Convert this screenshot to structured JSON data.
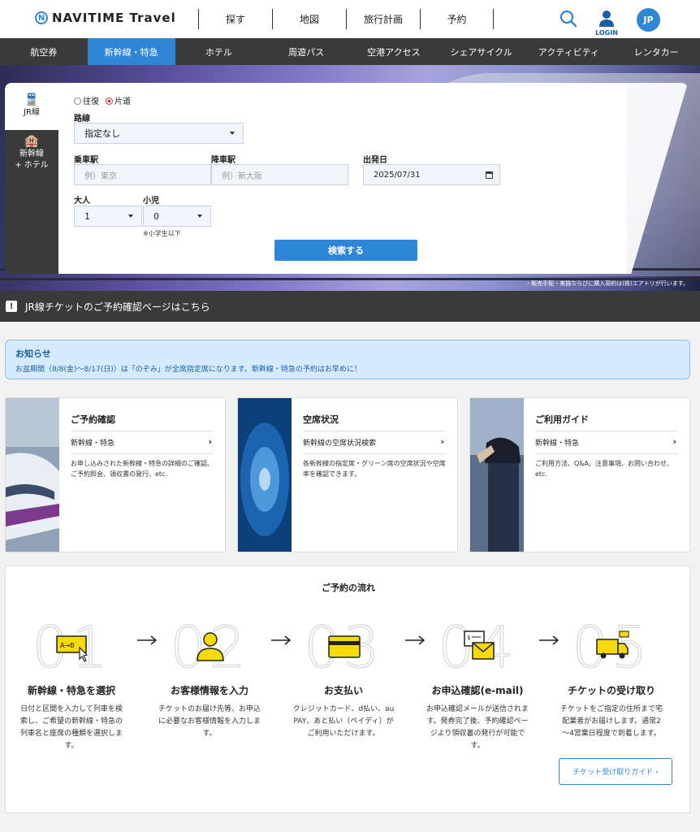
{
  "header": {
    "logo_mark": "N",
    "logo_text": "NAVITIME Travel",
    "nav": [
      "探す",
      "地図",
      "旅行計画",
      "予約"
    ],
    "login_label": "LOGIN",
    "avatar": "JP"
  },
  "categories": [
    "航空券",
    "新幹線・特急",
    "ホテル",
    "周遊パス",
    "空港アクセス",
    "シェアサイクル",
    "アクティビティ",
    "レンタカー"
  ],
  "active_category": "新幹線・特急",
  "sidebar": {
    "tabs": [
      {
        "label": "JR線",
        "icon": "train-icon"
      },
      {
        "label": "新幹線\n+ ホテル",
        "icon": "train-hotel-icon"
      }
    ]
  },
  "form": {
    "trip_round": "往復",
    "trip_oneway": "片道",
    "route_label": "路線",
    "route_value": "指定なし",
    "from_label": "乗車駅",
    "from_placeholder": "例）東京",
    "to_label": "降車駅",
    "to_placeholder": "例）新大阪",
    "date_label": "出発日",
    "date_value": "2025/07/31",
    "adult_label": "大人",
    "adult_value": "1",
    "child_label": "小児",
    "child_value": "0",
    "child_note": "※小学生以下",
    "search_button": "検索する"
  },
  "hero_disclaimer": "・販売手配・実施ならびに購入契約は(株)エアトリが行います。",
  "confirm_bar": {
    "icon": "!",
    "text": "JR線チケットのご予約確認ページはこちら"
  },
  "notice": {
    "title": "お知らせ",
    "text": "お盆期間（8/8(金)～8/17(日)）は「のぞみ」が全席指定席になります。新幹線・特急の予約はお早めに！"
  },
  "cards": [
    {
      "title": "ご予約確認",
      "link": "新幹線・特急",
      "desc": "お申し込みされた新幹線・特急の詳細のご確認、ご予約照会、領収書の発行、etc."
    },
    {
      "title": "空席状況",
      "link": "新幹線の空席状況検索",
      "desc": "各新幹線の指定席・グリーン席の空席状況や空席率を確認できます。"
    },
    {
      "title": "ご利用ガイド",
      "link": "新幹線・特急",
      "desc": "ご利用方法、Q&A、注意事項、お問い合わせ、etc."
    }
  ],
  "flow": {
    "title": "ご予約の流れ",
    "steps": [
      {
        "num": "01",
        "title": "新幹線・特急を選択",
        "desc": "日付と区間を入力して列車を検索し、ご希望の新幹線・特急の列車名と座席の種類を選択します。",
        "icon": "route-select-icon"
      },
      {
        "num": "02",
        "title": "お客様情報を入力",
        "desc": "チケットのお届け先等、お申込に必要なお客様情報を入力します。",
        "icon": "person-icon"
      },
      {
        "num": "03",
        "title": "お支払い",
        "desc": "クレジットカード、d払い、au PAY、あと払い（ペイディ）がご利用いただけます。",
        "icon": "credit-card-icon"
      },
      {
        "num": "04",
        "title": "お申込確認(e-mail)",
        "desc": "お申込確認メールが送信されます。発券完了後、予約確認ページより領収書の発行が可能です。",
        "icon": "mail-icon"
      },
      {
        "num": "05",
        "title": "チケットの受け取り",
        "desc": "チケットをご指定の住所まで宅配業者がお届けします。通常2～4営業日程度で到着します。",
        "icon": "truck-icon"
      }
    ],
    "guide_button": "チケット受け取りガイド ›"
  },
  "colors": {
    "accent": "#2f86d6",
    "dark_bar": "#3a3a3a",
    "notice_bg": "#d6eaff",
    "icon_yellow": "#f5d90a"
  }
}
